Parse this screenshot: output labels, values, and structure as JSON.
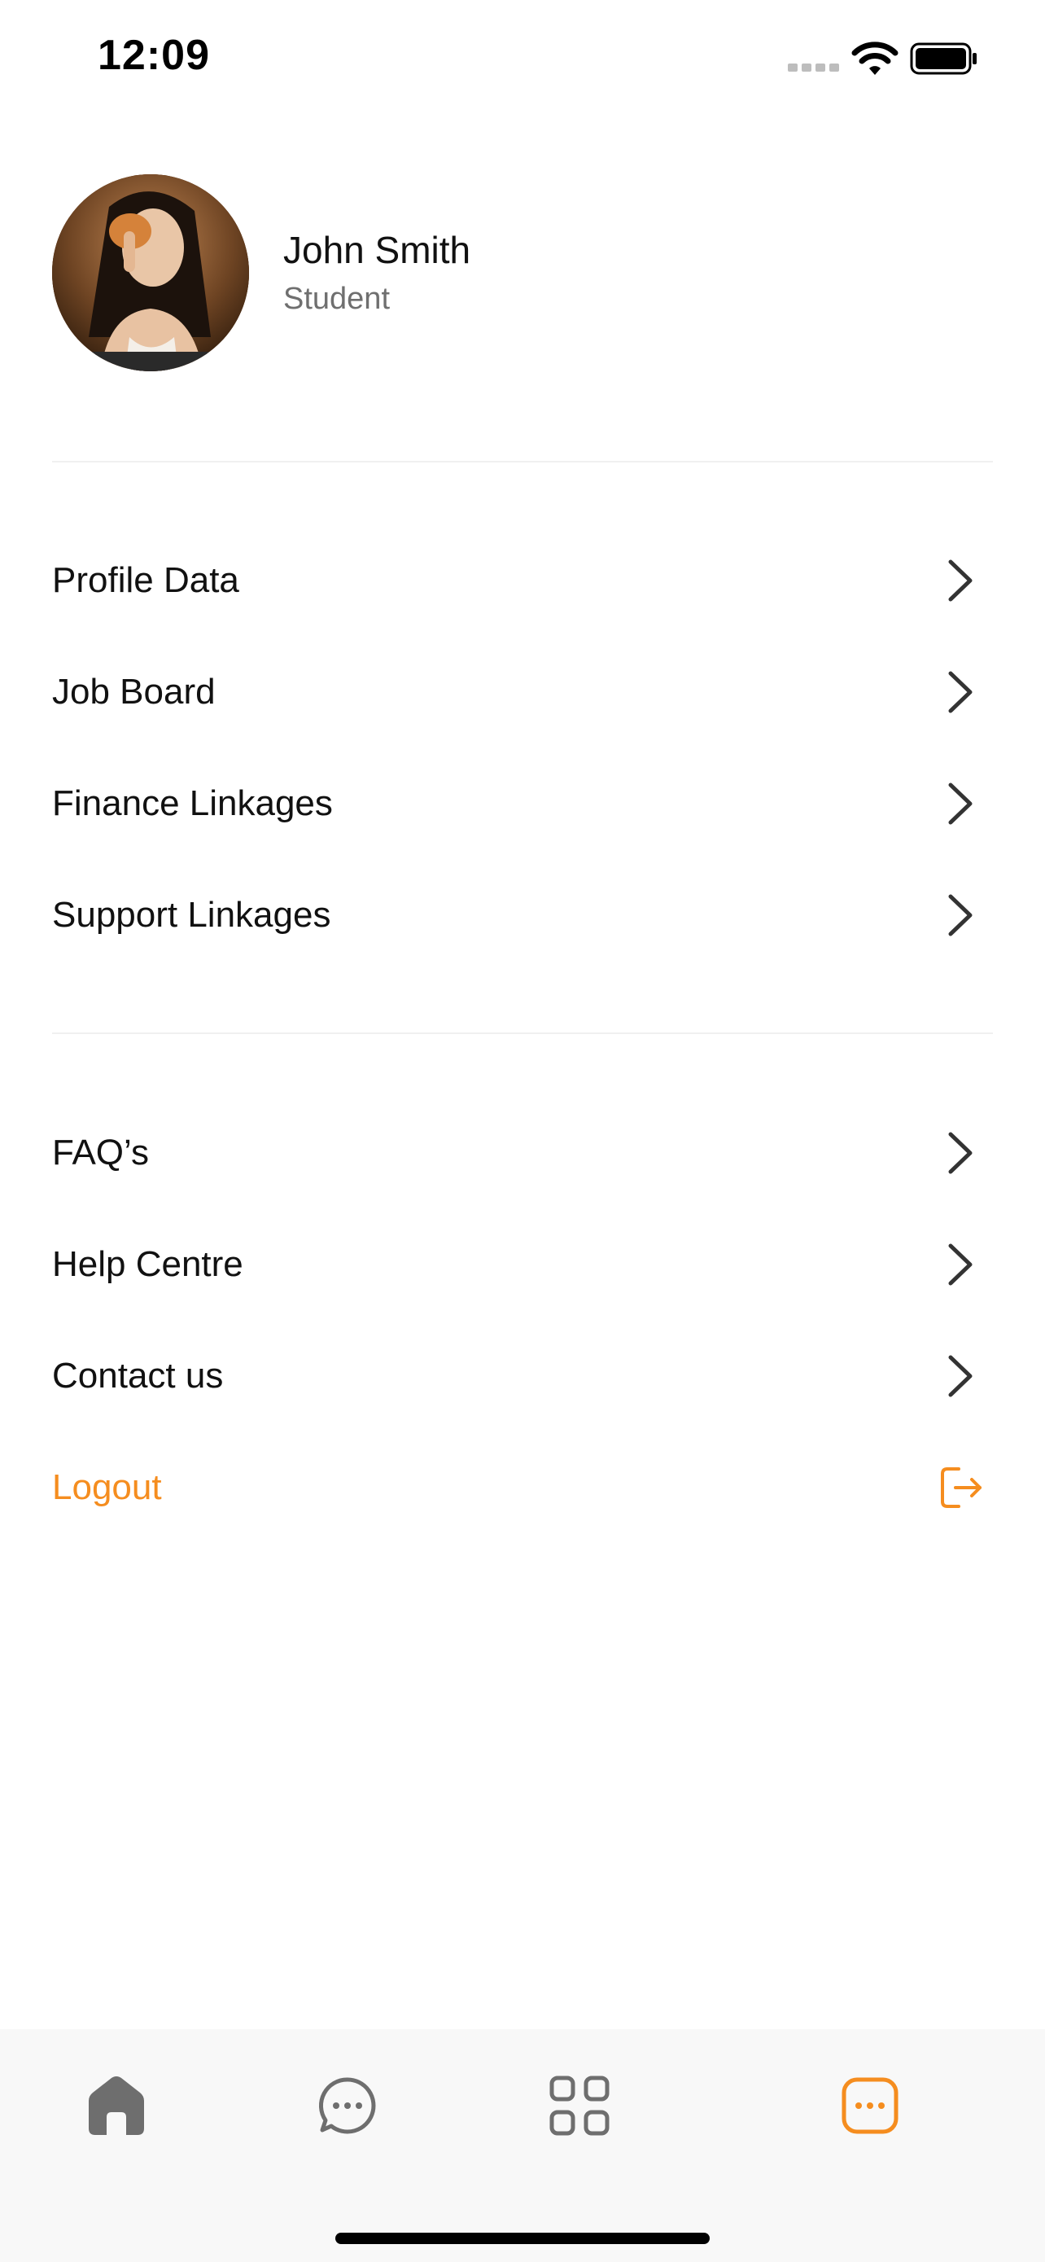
{
  "status_bar": {
    "time": "12:09",
    "icons": [
      "signal-icon",
      "wifi-icon",
      "battery-icon"
    ]
  },
  "profile": {
    "name": "John Smith",
    "role": "Student",
    "avatar": "profile-photo"
  },
  "menu_primary": [
    {
      "label": "Profile Data",
      "icon": "chevron-right-icon"
    },
    {
      "label": "Job Board",
      "icon": "chevron-right-icon"
    },
    {
      "label": "Finance Linkages",
      "icon": "chevron-right-icon"
    },
    {
      "label": "Support Linkages",
      "icon": "chevron-right-icon"
    }
  ],
  "menu_secondary": [
    {
      "label": "FAQ’s",
      "icon": "chevron-right-icon"
    },
    {
      "label": "Help Centre",
      "icon": "chevron-right-icon"
    },
    {
      "label": "Contact us",
      "icon": "chevron-right-icon"
    }
  ],
  "logout": {
    "label": "Logout",
    "icon": "logout-icon"
  },
  "tab_bar": {
    "tabs": [
      {
        "name": "home",
        "icon": "home-icon",
        "active": false
      },
      {
        "name": "messages",
        "icon": "chat-bubble-icon",
        "active": false
      },
      {
        "name": "apps",
        "icon": "grid-icon",
        "active": false
      },
      {
        "name": "more",
        "icon": "more-icon",
        "active": true
      }
    ]
  },
  "colors": {
    "accent": "#f58d1f",
    "text_primary": "#111111",
    "text_secondary": "#6f6f6f",
    "divider": "#f0f0f0",
    "tab_bar_bg": "#f8f8f8",
    "icon_inactive": "#6e6e6e"
  }
}
